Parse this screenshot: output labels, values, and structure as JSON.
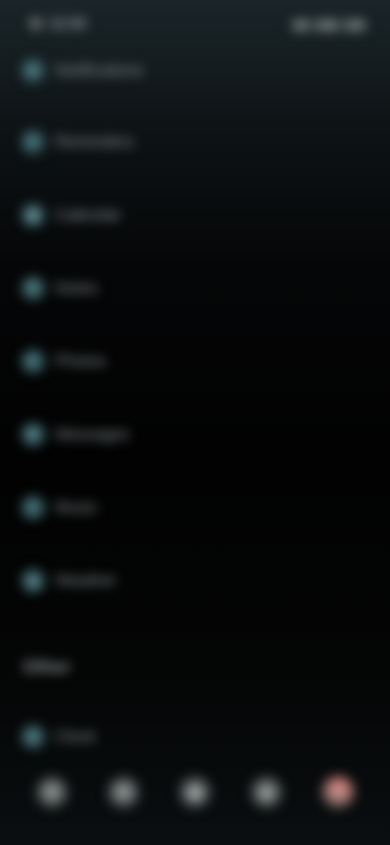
{
  "status_bar": {
    "time": "12:00",
    "icons": [
      "signal-icon",
      "wifi-icon",
      "battery-icon"
    ]
  },
  "list": {
    "items": [
      {
        "label": "Notifications",
        "value": "",
        "icon": "bell-icon",
        "glyph": "●"
      },
      {
        "label": "Reminders",
        "value": "",
        "icon": "check-icon",
        "glyph": "✓"
      },
      {
        "label": "Calendar",
        "value": "",
        "icon": "calendar-icon",
        "glyph": "▦"
      },
      {
        "label": "Notes",
        "value": "",
        "icon": "note-icon",
        "glyph": "✎"
      },
      {
        "label": "Photos",
        "value": "",
        "icon": "photo-icon",
        "glyph": "◐"
      },
      {
        "label": "Messages",
        "value": "",
        "icon": "message-icon",
        "glyph": "✉"
      },
      {
        "label": "Music",
        "value": "",
        "icon": "music-icon",
        "glyph": "♪"
      },
      {
        "label": "Weather",
        "value": "",
        "icon": "weather-icon",
        "glyph": "☁"
      }
    ]
  },
  "section": {
    "title": "Other",
    "items": [
      {
        "label": "Clock",
        "value": "",
        "icon": "clock-icon",
        "glyph": "◷"
      }
    ]
  },
  "dock": {
    "items": [
      {
        "name": "phone-icon",
        "glyph": "✆"
      },
      {
        "name": "message-icon",
        "glyph": "✉"
      },
      {
        "name": "camera-icon",
        "glyph": "◉"
      },
      {
        "name": "browser-icon",
        "glyph": "◍"
      },
      {
        "name": "settings-icon",
        "glyph": "⚙",
        "badge": true
      }
    ]
  },
  "colors": {
    "accent": "#e07a70",
    "icon_tint": "#4d7a80"
  }
}
